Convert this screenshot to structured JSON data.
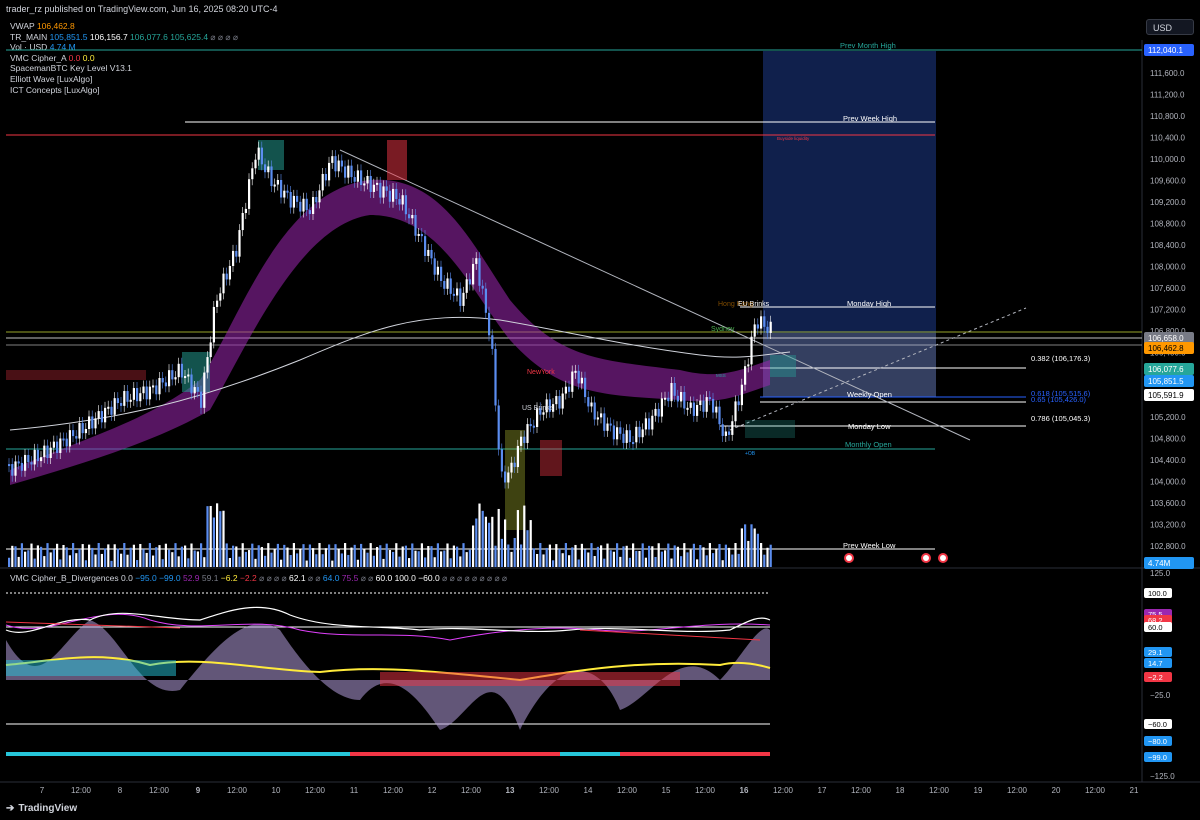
{
  "header": {
    "published_line": "trader_rz published on TradingView.com, Jun 16, 2025 08:20 UTC-4"
  },
  "currency_button": "USD",
  "legend": [
    {
      "name": "VWAP",
      "values": [
        {
          "v": "106,462.8",
          "color": "#ff9800"
        }
      ]
    },
    {
      "name": "TR_MAIN",
      "values": [
        {
          "v": "105,851.5",
          "color": "#2196f3"
        },
        {
          "v": "106,156.7",
          "color": "#ffffff"
        },
        {
          "v": "106,077.6",
          "color": "#26a69a"
        },
        {
          "v": "105,625.4",
          "color": "#26a69a"
        },
        {
          "v": "⌀ ⌀ ⌀ ⌀",
          "color": "#787b86"
        }
      ]
    },
    {
      "name": "Vol · USD",
      "values": [
        {
          "v": "4.74 M",
          "color": "#2196f3"
        }
      ]
    },
    {
      "name": "VMC Cipher_A",
      "values": [
        {
          "v": "0.0",
          "color": "#f23645"
        },
        {
          "v": "0.0",
          "color": "#ffeb3b"
        }
      ]
    },
    {
      "name": "SpacemanBTC Key Level V13.1",
      "values": []
    },
    {
      "name": "Elliott Wave [LuxAlgo]",
      "values": []
    },
    {
      "name": "ICT Concepts [LuxAlgo]",
      "values": []
    }
  ],
  "chart_annotations": {
    "prev_month_high": "Prev Month High",
    "prev_week_high": "Prev Week High",
    "buyside_liquidity": "Buyside liquidity",
    "monday_high": "Monday High",
    "eu_brinks": "EU Brinks",
    "honk": "Hong Kong",
    "sydney": "Sydney",
    "fib_0382": "0.382 (106,176.3)",
    "fib_0618": "0.618 (105,515.6)",
    "fib_065": "0.65 (105,426.0)",
    "fib_0786": "0.786 (105,045.3)",
    "weekly_open": "Weekly Open",
    "monday_low": "Monday Low",
    "monthly_open": "Monthly Open",
    "newyork": "NewYork",
    "us_brinks": "US Brinks",
    "mss": "MSS",
    "ob": "+OB",
    "prev_week_low": "Prev Week Low"
  },
  "price_axis": {
    "ticks": [
      "111,600.0",
      "111,200.0",
      "110,800.0",
      "110,400.0",
      "110,000.0",
      "109,600.0",
      "109,200.0",
      "108,800.0",
      "108,400.0",
      "108,000.0",
      "107,600.0",
      "107,200.0",
      "106,800.0",
      "106,400.0",
      "106,000.0",
      "105,600.0",
      "105,200.0",
      "104,800.0",
      "104,400.0",
      "104,000.0",
      "103,600.0",
      "103,200.0",
      "102,800.0"
    ],
    "badges": [
      {
        "label": "112,040.1",
        "bg": "#2962ff",
        "fg": "#ffffff"
      },
      {
        "label": "106,658.0",
        "bg": "#787b86",
        "fg": "#ffffff"
      },
      {
        "label": "106,462.8",
        "bg": "#ff9800",
        "fg": "#000000"
      },
      {
        "label": "106,077.6",
        "bg": "#26a69a",
        "fg": "#ffffff"
      },
      {
        "label": "105,851.5",
        "bg": "#2196f3",
        "fg": "#ffffff"
      },
      {
        "label": "105,591.9",
        "bg": "#ffffff",
        "fg": "#000000"
      },
      {
        "label": "4.74M",
        "bg": "#2196f3",
        "fg": "#ffffff"
      }
    ]
  },
  "vmcb": {
    "legend_title": "VMC Cipher_B_Divergences",
    "legend_values": [
      {
        "v": "0.0",
        "color": "#d1d4dc"
      },
      {
        "v": "−95.0",
        "color": "#2196f3"
      },
      {
        "v": "−99.0",
        "color": "#2196f3"
      },
      {
        "v": "52.9",
        "color": "#9c27b0"
      },
      {
        "v": "59.1",
        "color": "#787b86"
      },
      {
        "v": "−6.2",
        "color": "#ffeb3b"
      },
      {
        "v": "−2.2",
        "color": "#f23645"
      },
      {
        "v": "⌀ ⌀ ⌀ ⌀",
        "color": "#787b86"
      },
      {
        "v": "62.1",
        "color": "#ffffff"
      },
      {
        "v": "⌀ ⌀",
        "color": "#787b86"
      },
      {
        "v": "64.0",
        "color": "#2196f3"
      },
      {
        "v": "75.5",
        "color": "#9c27b0"
      },
      {
        "v": "⌀ ⌀",
        "color": "#787b86"
      },
      {
        "v": "60.0",
        "color": "#ffffff"
      },
      {
        "v": "100.0",
        "color": "#ffffff"
      },
      {
        "v": "−60.0",
        "color": "#ffffff"
      },
      {
        "v": "⌀ ⌀ ⌀ ⌀ ⌀ ⌀ ⌀ ⌀ ⌀",
        "color": "#787b86"
      }
    ],
    "axis_ticks": [
      "125.0",
      "−25.0",
      "−125.0"
    ],
    "badges": [
      {
        "label": "100.0",
        "bg": "#ffffff",
        "fg": "#000000"
      },
      {
        "label": "75.5",
        "bg": "#9c27b0",
        "fg": "#ffffff"
      },
      {
        "label": "68.2",
        "bg": "#f23645",
        "fg": "#ffffff"
      },
      {
        "label": "60.0",
        "bg": "#ffffff",
        "fg": "#000000"
      },
      {
        "label": "29.1",
        "bg": "#2196f3",
        "fg": "#ffffff"
      },
      {
        "label": "14.7",
        "bg": "#2196f3",
        "fg": "#ffffff"
      },
      {
        "label": "−2.2",
        "bg": "#f23645",
        "fg": "#ffffff"
      },
      {
        "label": "−60.0",
        "bg": "#ffffff",
        "fg": "#000000"
      },
      {
        "label": "−80.0",
        "bg": "#2196f3",
        "fg": "#ffffff"
      },
      {
        "label": "−99.0",
        "bg": "#2196f3",
        "fg": "#ffffff"
      }
    ]
  },
  "time_axis": [
    "7",
    "12:00",
    "8",
    "12:00",
    "9",
    "12:00",
    "10",
    "12:00",
    "11",
    "12:00",
    "12",
    "12:00",
    "13",
    "12:00",
    "14",
    "12:00",
    "15",
    "12:00",
    "16",
    "12:00",
    "17",
    "12:00",
    "18",
    "12:00",
    "19",
    "12:00",
    "20",
    "12:00",
    "21"
  ],
  "footer": {
    "brand": "TradingView"
  },
  "colors": {
    "up": "#ffffff",
    "down": "#2962ff",
    "ribbon": "#9c27b0",
    "target_zone": "#1e3a8a"
  }
}
